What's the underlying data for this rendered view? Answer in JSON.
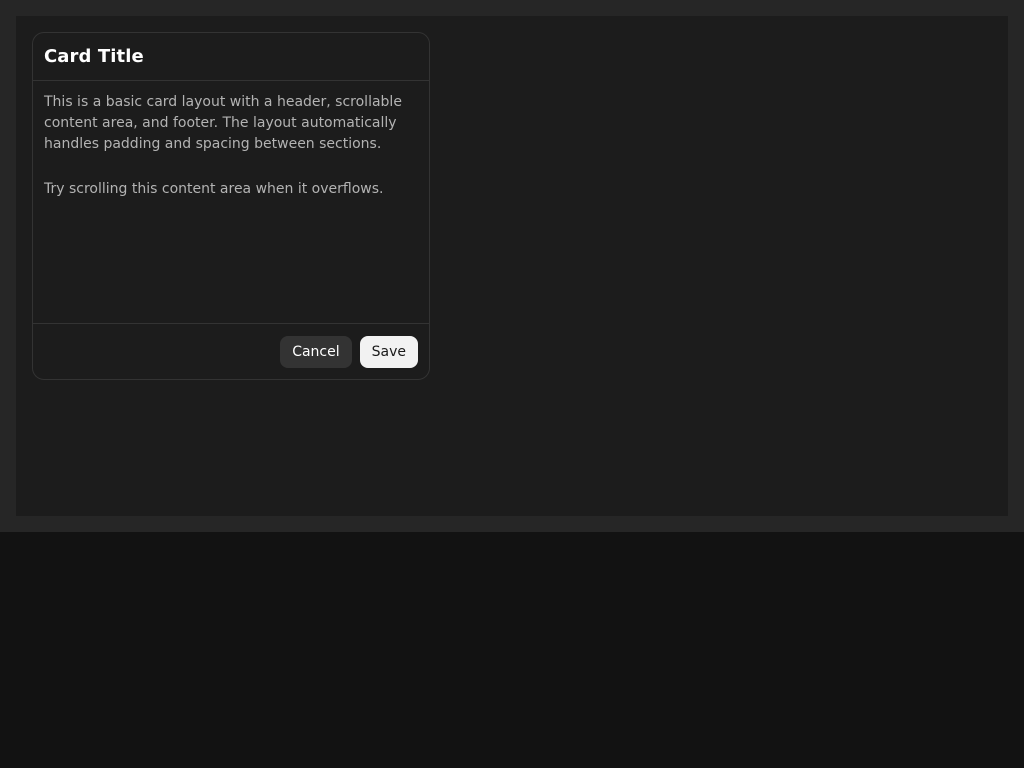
{
  "card": {
    "title": "Card Title",
    "paragraphs": [
      "This is a basic card layout with a header, scrollable content area, and footer. The layout automatically handles padding and spacing between sections.",
      "Try scrolling this content area when it overflows."
    ],
    "actions": {
      "cancel_label": "Cancel",
      "save_label": "Save"
    }
  },
  "colors": {
    "page_background": "#121212",
    "frame_background": "#262626",
    "card_background": "#1c1c1c",
    "border": "#333333",
    "title_text": "#ffffff",
    "body_text": "#b3b3b3",
    "secondary_button": "#333333",
    "primary_button": "#f2f2f2"
  }
}
